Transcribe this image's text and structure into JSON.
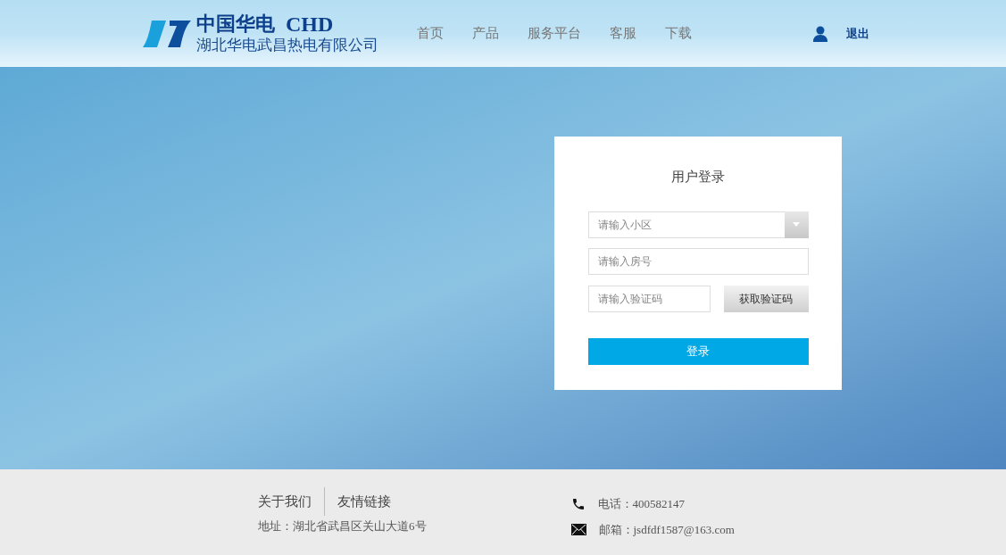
{
  "header": {
    "logo_title": "中国华电",
    "logo_abbr": "CHD",
    "logo_subtitle": "湖北华电武昌热电有限公司",
    "nav": [
      {
        "label": "首页"
      },
      {
        "label": "产品"
      },
      {
        "label": "服务平台"
      },
      {
        "label": "客服"
      },
      {
        "label": "下载"
      }
    ],
    "logout": "退出"
  },
  "login": {
    "title": "用户登录",
    "community": {
      "placeholder": "请输入小区"
    },
    "room": {
      "placeholder": "请输入房号"
    },
    "code": {
      "placeholder": "请输入验证码"
    },
    "get_code": "获取验证码",
    "submit": "登录"
  },
  "footer": {
    "links": [
      "关于我们",
      "友情链接"
    ],
    "address": "地址：湖北省武昌区关山大道6号",
    "phone": "电话：400582147",
    "email": "邮箱：jsdfdf1587@163.com"
  }
}
